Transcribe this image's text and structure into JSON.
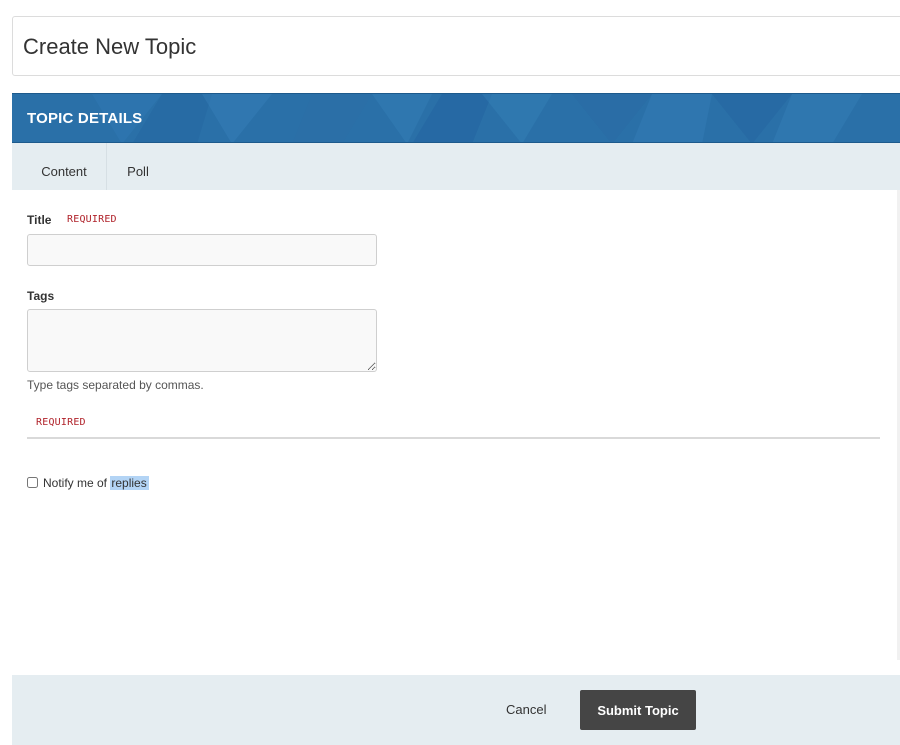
{
  "header": {
    "title": "Create New Topic"
  },
  "section": {
    "title": "TOPIC DETAILS",
    "color": "#2a70a8"
  },
  "tabs": [
    {
      "label": "Content",
      "active": true
    },
    {
      "label": "Poll",
      "active": false
    }
  ],
  "form": {
    "title_field": {
      "label": "Title",
      "required_tag": "REQUIRED",
      "value": "",
      "placeholder": ""
    },
    "tags_field": {
      "label": "Tags",
      "value": "",
      "placeholder": "",
      "hint": "Type tags separated by commas."
    },
    "editor": {
      "required_tag": "REQUIRED"
    },
    "notify": {
      "label_prefix": "Notify me of ",
      "label_highlight": "replies",
      "checked": false
    }
  },
  "footer": {
    "cancel_label": "Cancel",
    "submit_label": "Submit Topic"
  },
  "colors": {
    "required": "#b0222a",
    "tab_strip": "#e5edf1",
    "submit_button": "#454545",
    "selection_highlight": "#b3d4f5"
  }
}
